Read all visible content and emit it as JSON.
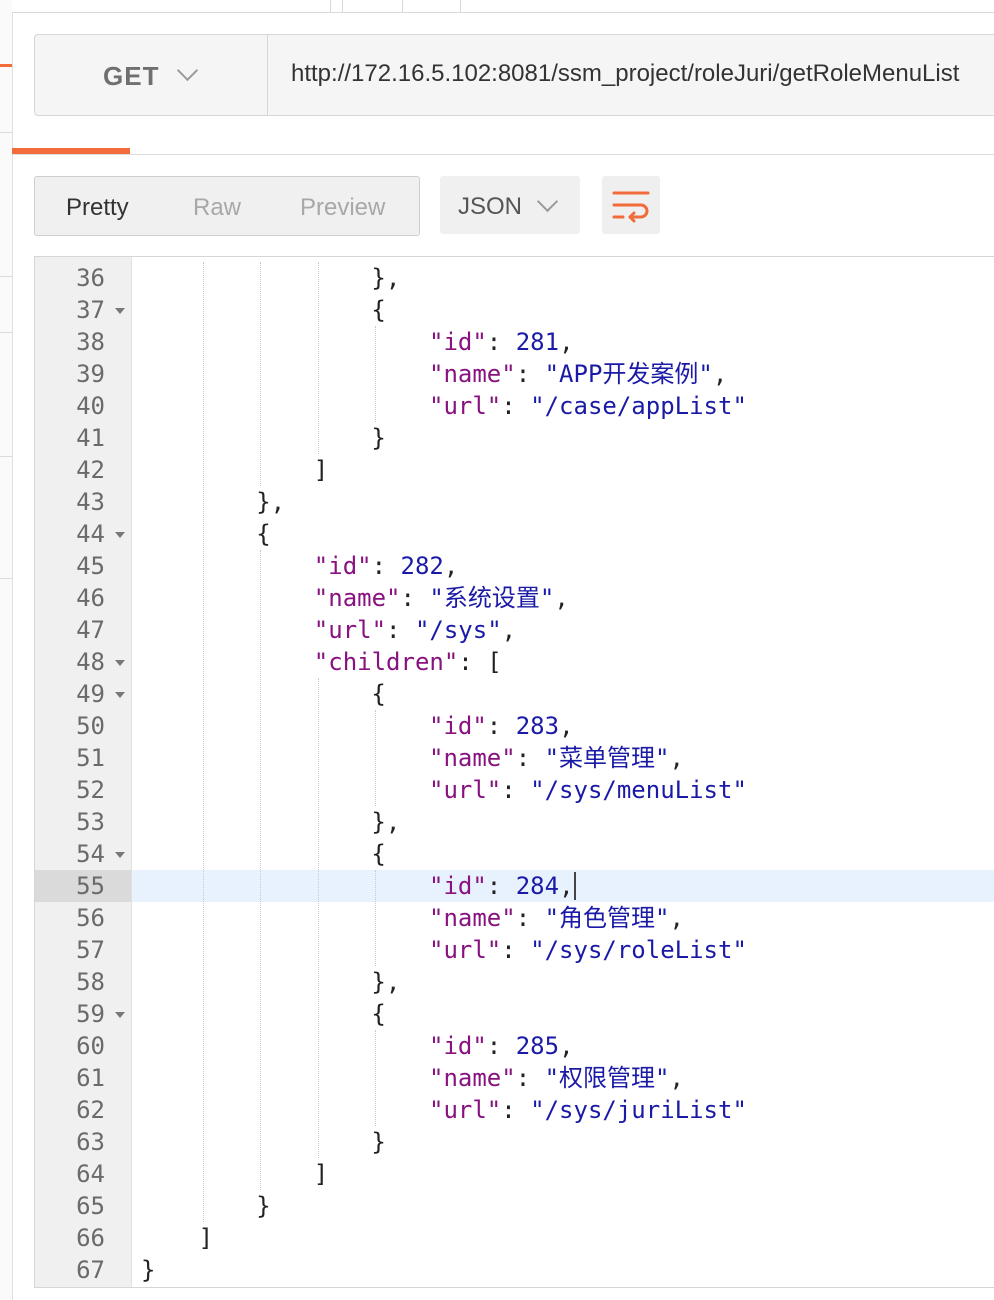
{
  "request": {
    "method": "GET",
    "url": "http://172.16.5.102:8081/ssm_project/roleJuri/getRoleMenuList"
  },
  "response_view": {
    "modes": [
      "Pretty",
      "Raw",
      "Preview"
    ],
    "active_mode": "Pretty",
    "format": "JSON",
    "wrap_icon": "wrap-lines-icon"
  },
  "editor": {
    "active_line": 55,
    "lines": [
      {
        "n": 36,
        "fold": false,
        "ind": 4,
        "t": [
          [
            "p",
            "},"
          ]
        ]
      },
      {
        "n": 37,
        "fold": true,
        "ind": 4,
        "t": [
          [
            "p",
            "{"
          ]
        ]
      },
      {
        "n": 38,
        "fold": false,
        "ind": 5,
        "t": [
          [
            "k",
            "\"id\""
          ],
          [
            "p",
            ": "
          ],
          [
            "n",
            "281"
          ],
          [
            "p",
            ","
          ]
        ]
      },
      {
        "n": 39,
        "fold": false,
        "ind": 5,
        "t": [
          [
            "k",
            "\"name\""
          ],
          [
            "p",
            ": "
          ],
          [
            "s",
            "\"APP开发案例\""
          ],
          [
            "p",
            ","
          ]
        ]
      },
      {
        "n": 40,
        "fold": false,
        "ind": 5,
        "t": [
          [
            "k",
            "\"url\""
          ],
          [
            "p",
            ": "
          ],
          [
            "s",
            "\"/case/appList\""
          ]
        ]
      },
      {
        "n": 41,
        "fold": false,
        "ind": 4,
        "t": [
          [
            "p",
            "}"
          ]
        ]
      },
      {
        "n": 42,
        "fold": false,
        "ind": 3,
        "t": [
          [
            "p",
            "]"
          ]
        ]
      },
      {
        "n": 43,
        "fold": false,
        "ind": 2,
        "t": [
          [
            "p",
            "},"
          ]
        ]
      },
      {
        "n": 44,
        "fold": true,
        "ind": 2,
        "t": [
          [
            "p",
            "{"
          ]
        ]
      },
      {
        "n": 45,
        "fold": false,
        "ind": 3,
        "t": [
          [
            "k",
            "\"id\""
          ],
          [
            "p",
            ": "
          ],
          [
            "n",
            "282"
          ],
          [
            "p",
            ","
          ]
        ]
      },
      {
        "n": 46,
        "fold": false,
        "ind": 3,
        "t": [
          [
            "k",
            "\"name\""
          ],
          [
            "p",
            ": "
          ],
          [
            "s",
            "\"系统设置\""
          ],
          [
            "p",
            ","
          ]
        ]
      },
      {
        "n": 47,
        "fold": false,
        "ind": 3,
        "t": [
          [
            "k",
            "\"url\""
          ],
          [
            "p",
            ": "
          ],
          [
            "s",
            "\"/sys\""
          ],
          [
            "p",
            ","
          ]
        ]
      },
      {
        "n": 48,
        "fold": true,
        "ind": 3,
        "t": [
          [
            "k",
            "\"children\""
          ],
          [
            "p",
            ": ["
          ]
        ]
      },
      {
        "n": 49,
        "fold": true,
        "ind": 4,
        "t": [
          [
            "p",
            "{"
          ]
        ]
      },
      {
        "n": 50,
        "fold": false,
        "ind": 5,
        "t": [
          [
            "k",
            "\"id\""
          ],
          [
            "p",
            ": "
          ],
          [
            "n",
            "283"
          ],
          [
            "p",
            ","
          ]
        ]
      },
      {
        "n": 51,
        "fold": false,
        "ind": 5,
        "t": [
          [
            "k",
            "\"name\""
          ],
          [
            "p",
            ": "
          ],
          [
            "s",
            "\"菜单管理\""
          ],
          [
            "p",
            ","
          ]
        ]
      },
      {
        "n": 52,
        "fold": false,
        "ind": 5,
        "t": [
          [
            "k",
            "\"url\""
          ],
          [
            "p",
            ": "
          ],
          [
            "s",
            "\"/sys/menuList\""
          ]
        ]
      },
      {
        "n": 53,
        "fold": false,
        "ind": 4,
        "t": [
          [
            "p",
            "},"
          ]
        ]
      },
      {
        "n": 54,
        "fold": true,
        "ind": 4,
        "t": [
          [
            "p",
            "{"
          ]
        ]
      },
      {
        "n": 55,
        "fold": false,
        "ind": 5,
        "t": [
          [
            "k",
            "\"id\""
          ],
          [
            "p",
            ": "
          ],
          [
            "n",
            "284"
          ],
          [
            "p",
            ","
          ]
        ]
      },
      {
        "n": 56,
        "fold": false,
        "ind": 5,
        "t": [
          [
            "k",
            "\"name\""
          ],
          [
            "p",
            ": "
          ],
          [
            "s",
            "\"角色管理\""
          ],
          [
            "p",
            ","
          ]
        ]
      },
      {
        "n": 57,
        "fold": false,
        "ind": 5,
        "t": [
          [
            "k",
            "\"url\""
          ],
          [
            "p",
            ": "
          ],
          [
            "s",
            "\"/sys/roleList\""
          ]
        ]
      },
      {
        "n": 58,
        "fold": false,
        "ind": 4,
        "t": [
          [
            "p",
            "},"
          ]
        ]
      },
      {
        "n": 59,
        "fold": true,
        "ind": 4,
        "t": [
          [
            "p",
            "{"
          ]
        ]
      },
      {
        "n": 60,
        "fold": false,
        "ind": 5,
        "t": [
          [
            "k",
            "\"id\""
          ],
          [
            "p",
            ": "
          ],
          [
            "n",
            "285"
          ],
          [
            "p",
            ","
          ]
        ]
      },
      {
        "n": 61,
        "fold": false,
        "ind": 5,
        "t": [
          [
            "k",
            "\"name\""
          ],
          [
            "p",
            ": "
          ],
          [
            "s",
            "\"权限管理\""
          ],
          [
            "p",
            ","
          ]
        ]
      },
      {
        "n": 62,
        "fold": false,
        "ind": 5,
        "t": [
          [
            "k",
            "\"url\""
          ],
          [
            "p",
            ": "
          ],
          [
            "s",
            "\"/sys/juriList\""
          ]
        ]
      },
      {
        "n": 63,
        "fold": false,
        "ind": 4,
        "t": [
          [
            "p",
            "}"
          ]
        ]
      },
      {
        "n": 64,
        "fold": false,
        "ind": 3,
        "t": [
          [
            "p",
            "]"
          ]
        ]
      },
      {
        "n": 65,
        "fold": false,
        "ind": 2,
        "t": [
          [
            "p",
            "}"
          ]
        ]
      },
      {
        "n": 66,
        "fold": false,
        "ind": 1,
        "t": [
          [
            "p",
            "]"
          ]
        ]
      },
      {
        "n": 67,
        "fold": false,
        "ind": 0,
        "t": [
          [
            "p",
            "}"
          ]
        ]
      }
    ]
  },
  "colors": {
    "accent": "#f26b3a",
    "json_key": "#881280",
    "json_value": "#1a1aa6",
    "active_line": "#e8f2fe"
  }
}
